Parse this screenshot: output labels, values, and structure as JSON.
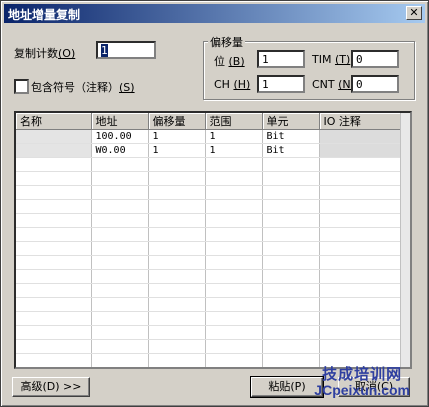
{
  "dialog": {
    "title": "地址增量复制"
  },
  "copy_count": {
    "label": "复制计数",
    "hotkey": "(O)",
    "value": "1"
  },
  "include_symbol": {
    "label": "包含符号（注释）",
    "hotkey": "(S)",
    "checked": false
  },
  "offset_group": {
    "title": "偏移量",
    "bit": {
      "label": "位",
      "hotkey": "(B)",
      "value": "1"
    },
    "ch": {
      "label": "CH",
      "hotkey": "(H)",
      "value": "1"
    },
    "tim": {
      "label": "TIM",
      "hotkey": "(T)",
      "value": "0"
    },
    "cnt": {
      "label": "CNT",
      "hotkey": "(N)",
      "value": "0"
    }
  },
  "grid": {
    "columns": [
      "名称",
      "地址",
      "偏移量",
      "范围",
      "单元",
      "IO 注释"
    ],
    "rows": [
      [
        "",
        "100.00",
        "1",
        "1",
        "Bit",
        ""
      ],
      [
        "",
        "W0.00",
        "1",
        "1",
        "Bit",
        ""
      ]
    ]
  },
  "buttons": {
    "advanced": "高级(D) >>",
    "paste": "粘贴(P)",
    "cancel": "取消(C)"
  },
  "watermark": {
    "cn": "技成培训网",
    "en": "JCpeixun.com"
  }
}
